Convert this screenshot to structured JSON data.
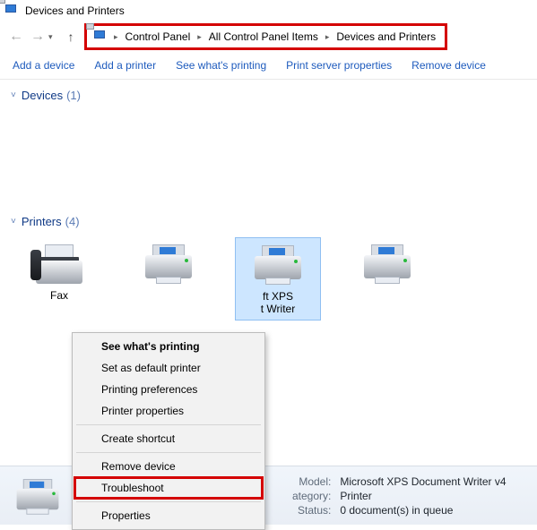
{
  "title": "Devices and Printers",
  "nav": {
    "crumbs": [
      "Control Panel",
      "All Control Panel Items",
      "Devices and Printers"
    ]
  },
  "toolbar": {
    "add_device": "Add a device",
    "add_printer": "Add a printer",
    "see_printing": "See what's printing",
    "server_props": "Print server properties",
    "remove": "Remove device"
  },
  "groups": {
    "devices": {
      "label": "Devices",
      "count": "(1)"
    },
    "printers": {
      "label": "Printers",
      "count": "(4)"
    }
  },
  "items": {
    "fax": "Fax",
    "xps_line1": "ft XPS",
    "xps_line2": "t Writer"
  },
  "context_menu": {
    "see": "See what's printing",
    "default": "Set as default printer",
    "prefs": "Printing preferences",
    "pprops": "Printer properties",
    "shortcut": "Create shortcut",
    "remove": "Remove device",
    "troubleshoot": "Troubleshoot",
    "properties": "Properties"
  },
  "details": {
    "model_k": "Model:",
    "model_v": "Microsoft XPS Document Writer v4",
    "cat_k": "ategory:",
    "cat_v": "Printer",
    "status_k": "Status:",
    "status_v": "0 document(s) in queue"
  }
}
